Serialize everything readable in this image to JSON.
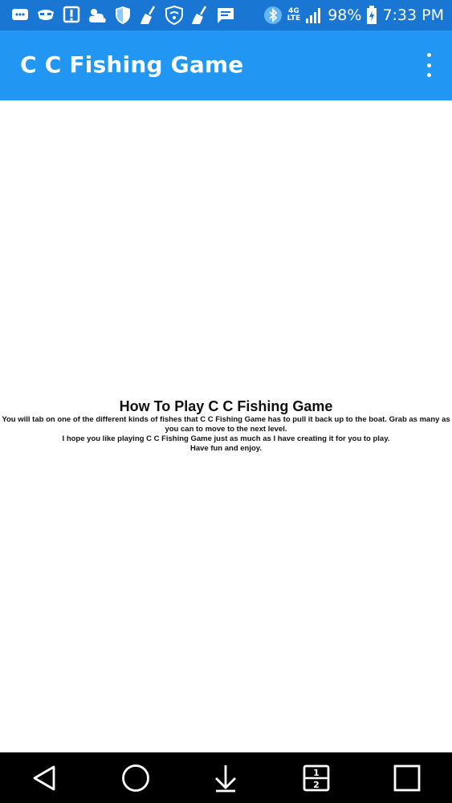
{
  "status_bar": {
    "network_top": "4G",
    "network_bottom": "LTE",
    "battery": "98%",
    "time": "7:33 PM"
  },
  "app_bar": {
    "title": "C C Fishing Game",
    "overflow_icon": "more-vert-icon"
  },
  "content": {
    "heading": "How To Play C C Fishing Game",
    "paragraph1": "You will tab on one of the different kinds of fishes that C C Fishing Game has to pull it back up to the boat. Grab as many as you can to move to the next level.",
    "paragraph2": "I hope you like playing C C Fishing Game just as much as I have creating it for you to play.",
    "paragraph3": "Have fun and enjoy."
  },
  "nav_bar": {
    "back_icon": "back-triangle-icon",
    "home_icon": "home-circle-icon",
    "notifications_icon": "download-arrow-icon",
    "dual_window_icon": "dual-window-icon",
    "recents_icon": "recents-square-icon",
    "dual_window_top": "1",
    "dual_window_bottom": "2"
  },
  "colors": {
    "status_bar": "#1976D2",
    "app_bar": "#2196F3",
    "nav_bar": "#000000",
    "background": "#FFFFFF"
  }
}
